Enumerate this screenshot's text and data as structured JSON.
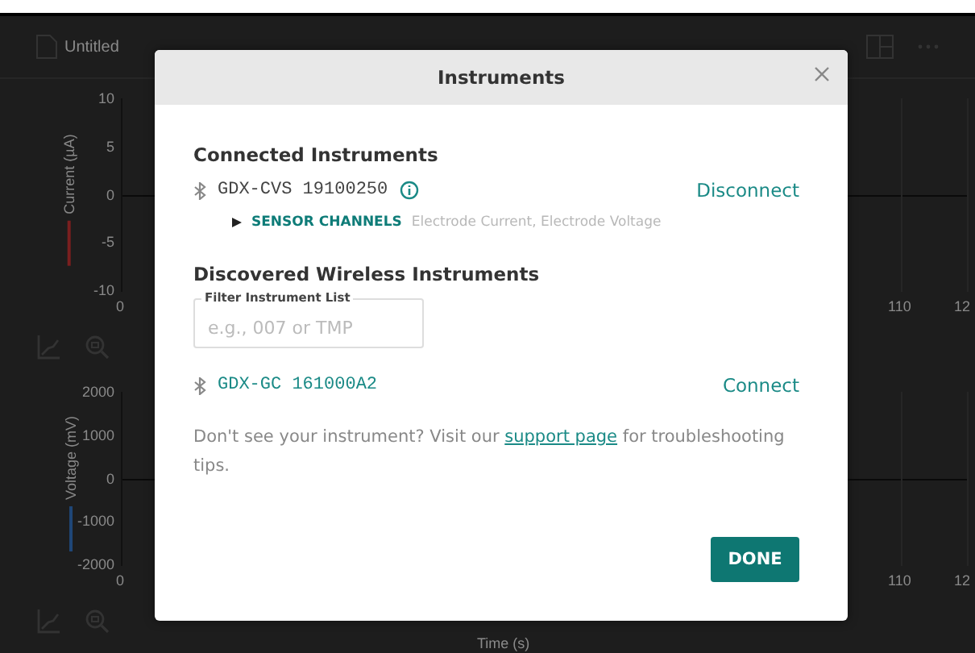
{
  "app": {
    "document_title": "Untitled",
    "graphs": [
      {
        "y_label": "Current (µA)",
        "color": "#7a1f1f",
        "y_ticks": [
          "10",
          "5",
          "0",
          "-5",
          "-10"
        ],
        "x_ticks": [
          "0",
          "110",
          "12"
        ]
      },
      {
        "y_label": "Voltage (mV)",
        "color": "#1f4778",
        "y_ticks": [
          "2000",
          "1000",
          "0",
          "-1000",
          "-2000"
        ],
        "x_ticks": [
          "0",
          "110",
          "12"
        ]
      }
    ],
    "x_label": "Time (s)"
  },
  "dialog": {
    "title": "Instruments",
    "connected": {
      "heading": "Connected Instruments",
      "instruments": [
        {
          "name": "GDX-CVS 19100250",
          "action": "Disconnect",
          "sensor_channels": {
            "label": "SENSOR CHANNELS",
            "expanded": false,
            "channels": "Electrode Current, Electrode Voltage"
          }
        }
      ]
    },
    "discovered": {
      "heading": "Discovered Wireless Instruments",
      "filter": {
        "label": "Filter Instrument List",
        "placeholder": "e.g., 007 or TMP"
      },
      "instruments": [
        {
          "name": "GDX-GC 161000A2",
          "action": "Connect"
        }
      ]
    },
    "help": {
      "before": "Don't see your instrument? Visit our ",
      "link": "support page",
      "after": " for troubleshooting tips."
    },
    "done_button": "DONE"
  }
}
